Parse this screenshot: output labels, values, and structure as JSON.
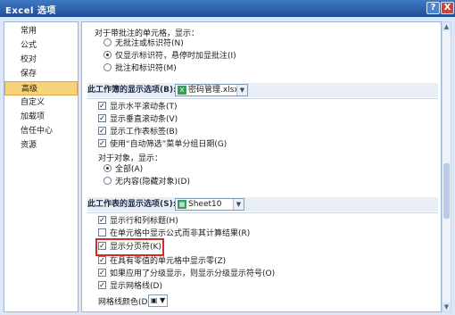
{
  "window": {
    "title": "Excel 选项",
    "help": "?",
    "close": "X"
  },
  "sidebar": {
    "items": [
      "常用",
      "公式",
      "校对",
      "保存",
      "高级",
      "自定义",
      "加载项",
      "信任中心",
      "资源"
    ],
    "selected": "高级"
  },
  "comments": {
    "prompt": "对于带批注的单元格，显示：",
    "options": [
      "无批注或标识符(N)",
      "仅显示标识符，悬停时加显批注(I)",
      "批注和标识符(M)"
    ]
  },
  "workbook": {
    "label": "此工作簿的显示选项(B):",
    "file": "密码管理.xlsx",
    "file_icon": "excel-file-icon",
    "checkboxes": [
      "显示水平滚动条(T)",
      "显示垂直滚动条(V)",
      "显示工作表标签(B)",
      "使用“自动筛选”菜单分组日期(G)"
    ],
    "objects_label": "对于对象，显示：",
    "objects": [
      "全部(A)",
      "无内容(隐藏对象)(D)"
    ]
  },
  "worksheet": {
    "label": "此工作表的显示选项(S):",
    "sheet": "Sheet10",
    "sheet_icon": "sheet-icon",
    "checkboxes": [
      "显示行和列标题(H)",
      "在单元格中显示公式而非其计算结果(R)",
      "显示分页符(K)",
      "在具有零值的单元格中显示零(Z)",
      "如果应用了分级显示，则显示分级显示符号(O)",
      "显示网格线(D)"
    ],
    "gridline_label": "网格线颜色(D)",
    "gridline_color_icon": "paint-bucket-icon"
  },
  "scroll": {
    "up": "▲",
    "down": "▼"
  }
}
